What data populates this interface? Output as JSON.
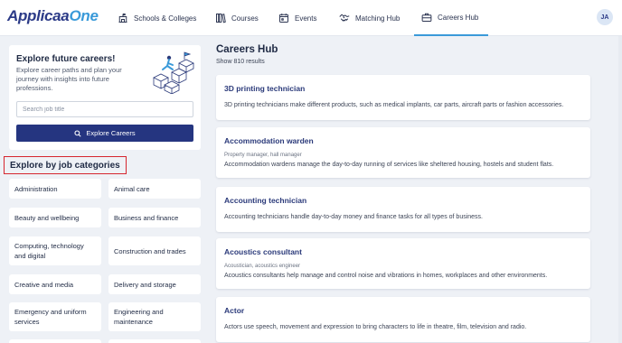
{
  "brand": {
    "name_part1": "Applicaa",
    "name_part2": "One"
  },
  "nav": {
    "items": [
      {
        "label": "Schools & Colleges",
        "icon": "school-icon"
      },
      {
        "label": "Courses",
        "icon": "books-icon"
      },
      {
        "label": "Events",
        "icon": "calendar-icon"
      },
      {
        "label": "Matching Hub",
        "icon": "handshake-icon"
      },
      {
        "label": "Careers Hub",
        "icon": "briefcase-icon",
        "active": true
      }
    ],
    "avatar_initials": "JA"
  },
  "explore": {
    "title": "Explore future careers!",
    "description": "Explore career paths and plan your journey with insights into future professions.",
    "search_placeholder": "Search job title",
    "button_label": "Explore Careers"
  },
  "categories": {
    "heading": "Explore by job categories",
    "items": [
      "Administration",
      "Animal care",
      "Beauty and wellbeing",
      "Business and finance",
      "Computing, technology and digital",
      "Construction and trades",
      "Creative and media",
      "Delivery and storage",
      "Emergency and uniform services",
      "Engineering and maintenance"
    ]
  },
  "hub": {
    "title": "Careers Hub",
    "result_count": "Show 810 results",
    "careers": [
      {
        "title": "3D printing technician",
        "subtitle": "",
        "description": "3D printing technicians make different products, such as medical implants, car parts, aircraft parts or fashion accessories."
      },
      {
        "title": "Accommodation warden",
        "subtitle": "Property manager, hall manager",
        "description": "Accommodation wardens manage the day-to-day running of services like sheltered housing, hostels and student flats."
      },
      {
        "title": "Accounting technician",
        "subtitle": "",
        "description": "Accounting technicians handle day-to-day money and finance tasks for all types of business."
      },
      {
        "title": "Acoustics consultant",
        "subtitle": "Acoustician, acoustics engineer",
        "description": "Acoustics consultants help manage and control noise and vibrations in homes, workplaces and other environments."
      },
      {
        "title": "Actor",
        "subtitle": "",
        "description": "Actors use speech, movement and expression to bring characters to life in theatre, film, television and radio."
      }
    ]
  },
  "colors": {
    "brand_dark": "#2b3a87",
    "brand_light": "#3a9ad9",
    "button": "#253580",
    "highlight": "#d6262f"
  }
}
